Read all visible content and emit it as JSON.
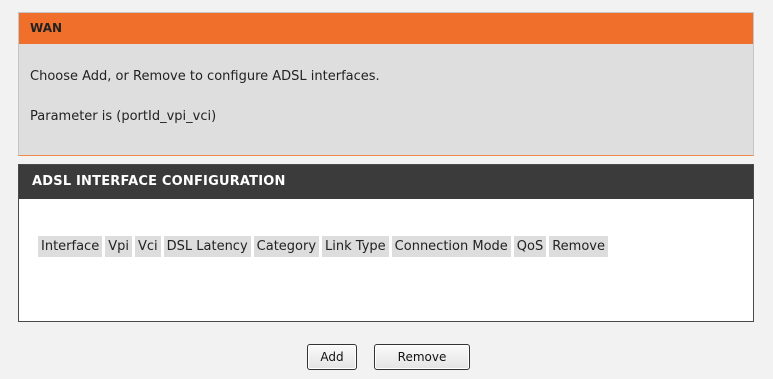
{
  "wan": {
    "title": "WAN",
    "instruction": "Choose Add, or Remove to configure ADSL interfaces.",
    "parameter": "Parameter is (portId_vpi_vci)"
  },
  "adsl_config": {
    "title": "ADSL INTERFACE CONFIGURATION",
    "columns": [
      "Interface",
      "Vpi",
      "Vci",
      "DSL Latency",
      "Category",
      "Link Type",
      "Connection Mode",
      "QoS",
      "Remove"
    ]
  },
  "buttons": {
    "add": "Add",
    "remove": "Remove"
  },
  "colors": {
    "wan_header": "#f06f2b",
    "wan_panel": "#dedede",
    "config_header": "#3b3b3b",
    "table_header_cell": "#dddddd"
  }
}
